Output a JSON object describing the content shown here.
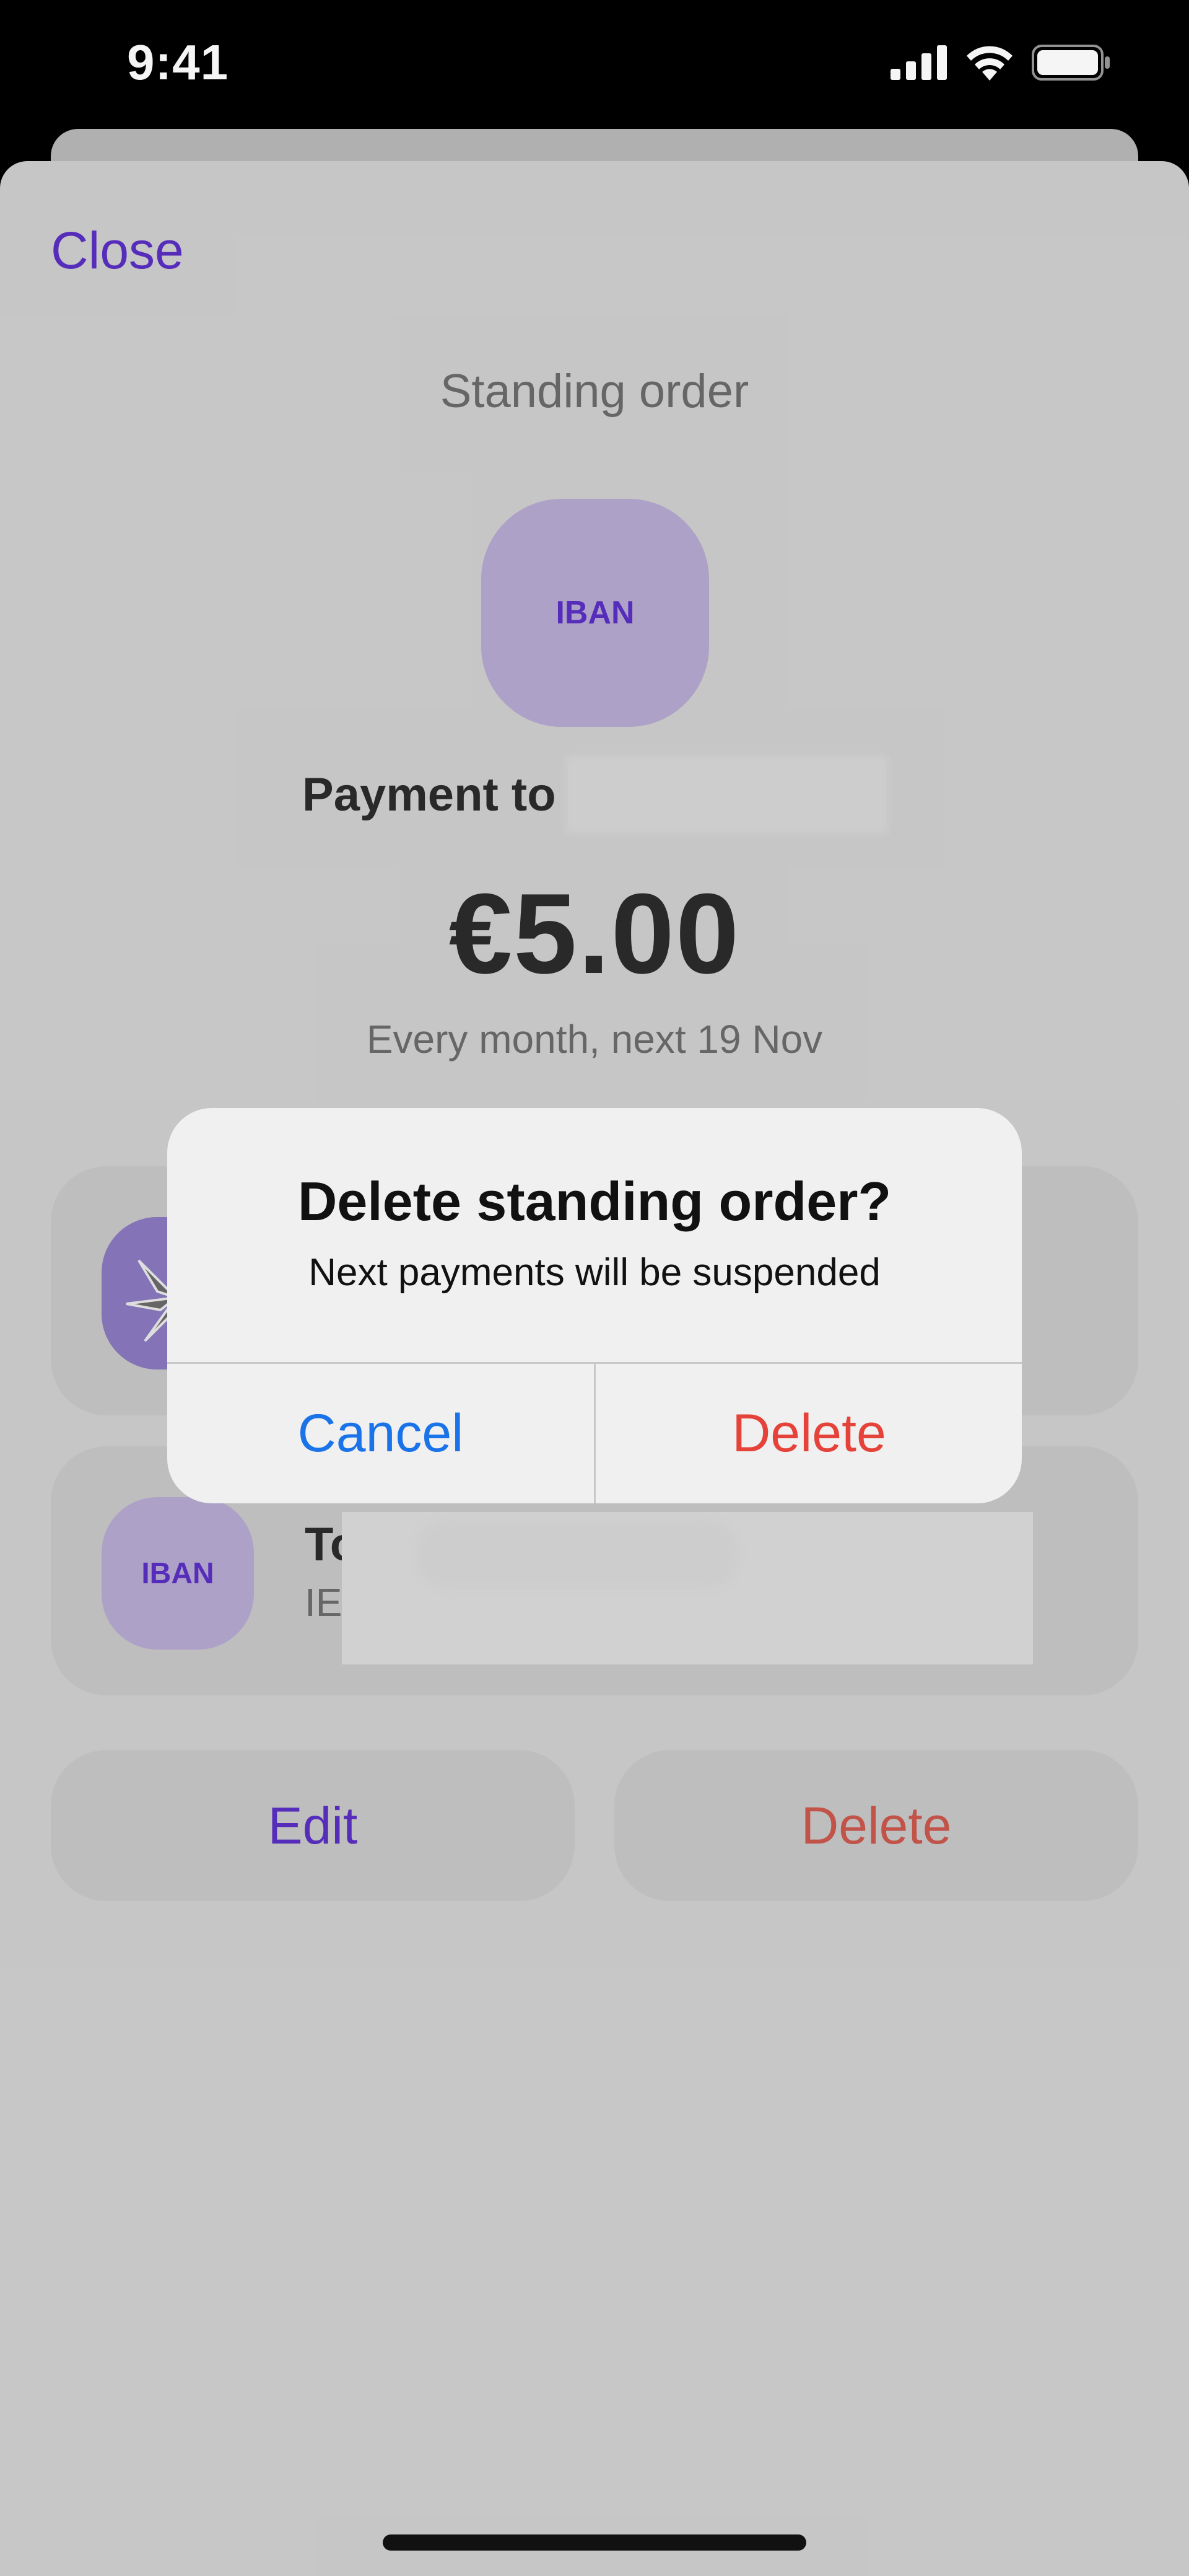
{
  "status_bar": {
    "time": "9:41",
    "icons": [
      "signal-icon",
      "wifi-icon",
      "battery-icon"
    ]
  },
  "header": {
    "close_label": "Close",
    "title": "Standing order"
  },
  "recipient": {
    "avatar_label": "IBAN",
    "payment_prefix": "Payment to"
  },
  "amount": "€5.00",
  "schedule": "Every month, next 19 Nov",
  "to_card": {
    "avatar_label": "IBAN",
    "title_prefix": "To",
    "sub_prefix": "IE"
  },
  "actions": {
    "edit_label": "Edit",
    "delete_label": "Delete"
  },
  "alert": {
    "title": "Delete standing order?",
    "message": "Next payments will be suspended",
    "cancel_label": "Cancel",
    "delete_label": "Delete"
  },
  "colors": {
    "accent": "#5a2fc2",
    "destructive": "#e5423a",
    "link_blue": "#1a73e8",
    "sheet_bg": "#cfcfcf"
  }
}
